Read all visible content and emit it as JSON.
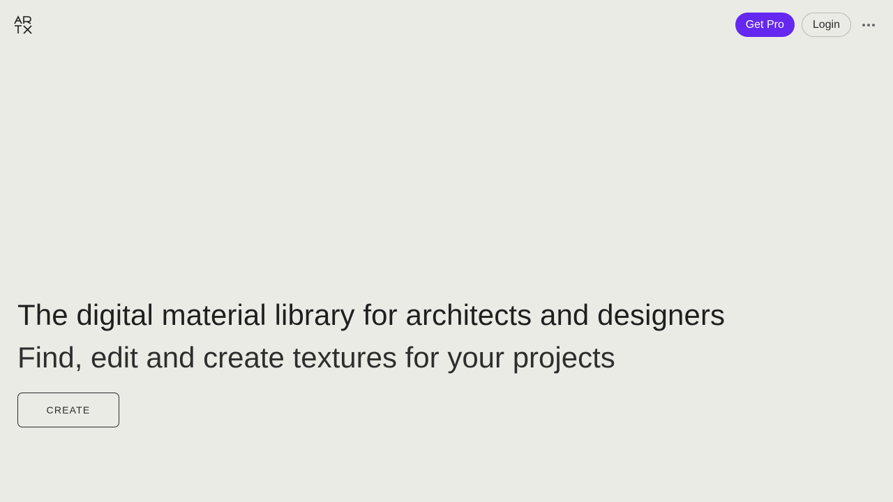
{
  "brand": {
    "logo_text": "ARTX"
  },
  "header": {
    "get_pro_label": "Get Pro",
    "login_label": "Login",
    "more_icon": "more-horizontal-icon"
  },
  "hero": {
    "title": "The digital material library for architects and designers",
    "subtitle": "Find, edit and create textures for your projects",
    "cta_label": "CREATE"
  },
  "colors": {
    "background": "#ebebe6",
    "accent": "#6428f0",
    "text": "#1f1f1f"
  }
}
